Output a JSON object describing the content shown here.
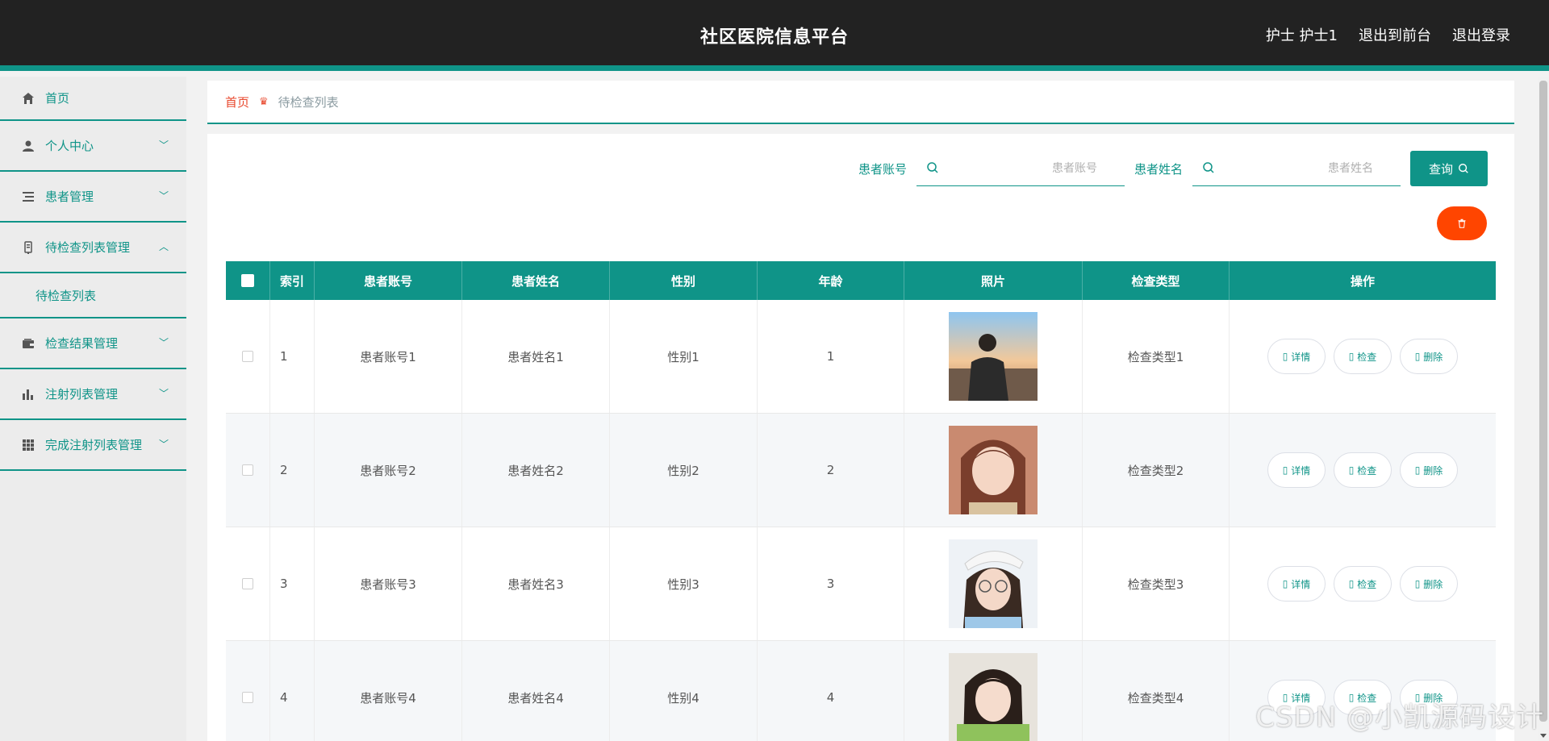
{
  "header": {
    "title": "社区医院信息平台",
    "user": "护士 护士1",
    "exit_front": "退出到前台",
    "logout": "退出登录"
  },
  "sidebar": {
    "items": [
      {
        "label": "首页",
        "icon": "home-icon"
      },
      {
        "label": "个人中心",
        "icon": "user-icon",
        "expandable": true
      },
      {
        "label": "患者管理",
        "icon": "list-icon",
        "expandable": true
      },
      {
        "label": "待检查列表管理",
        "icon": "clipboard-icon",
        "expanded": true
      },
      {
        "label": "检查结果管理",
        "icon": "wallet-icon",
        "expandable": true
      },
      {
        "label": "注射列表管理",
        "icon": "chart-icon",
        "expandable": true
      },
      {
        "label": "完成注射列表管理",
        "icon": "grid-icon",
        "expandable": true
      }
    ],
    "submenu": "待检查列表"
  },
  "breadcrumb": {
    "home": "首页",
    "current": "待检查列表"
  },
  "search": {
    "account_label": "患者账号",
    "account_placeholder": "患者账号",
    "name_label": "患者姓名",
    "name_placeholder": "患者姓名",
    "query_label": "查询"
  },
  "table": {
    "headers": [
      "索引",
      "患者账号",
      "患者姓名",
      "性别",
      "年龄",
      "照片",
      "检查类型",
      "操作"
    ],
    "rows": [
      {
        "idx": "1",
        "account": "患者账号1",
        "name": "患者姓名1",
        "sex": "性别1",
        "age": "1",
        "type": "检查类型1"
      },
      {
        "idx": "2",
        "account": "患者账号2",
        "name": "患者姓名2",
        "sex": "性别2",
        "age": "2",
        "type": "检查类型2"
      },
      {
        "idx": "3",
        "account": "患者账号3",
        "name": "患者姓名3",
        "sex": "性别3",
        "age": "3",
        "type": "检查类型3"
      },
      {
        "idx": "4",
        "account": "患者账号4",
        "name": "患者姓名4",
        "sex": "性别4",
        "age": "4",
        "type": "检查类型4"
      }
    ],
    "ops": {
      "detail": "详情",
      "check": "检查",
      "delete": "删除"
    }
  },
  "watermark": "CSDN @小凯源码设计",
  "colors": {
    "accent": "#0f9488",
    "header_bg": "#222222",
    "danger": "#ff4500",
    "breadcrumb_home": "#e8472c"
  }
}
